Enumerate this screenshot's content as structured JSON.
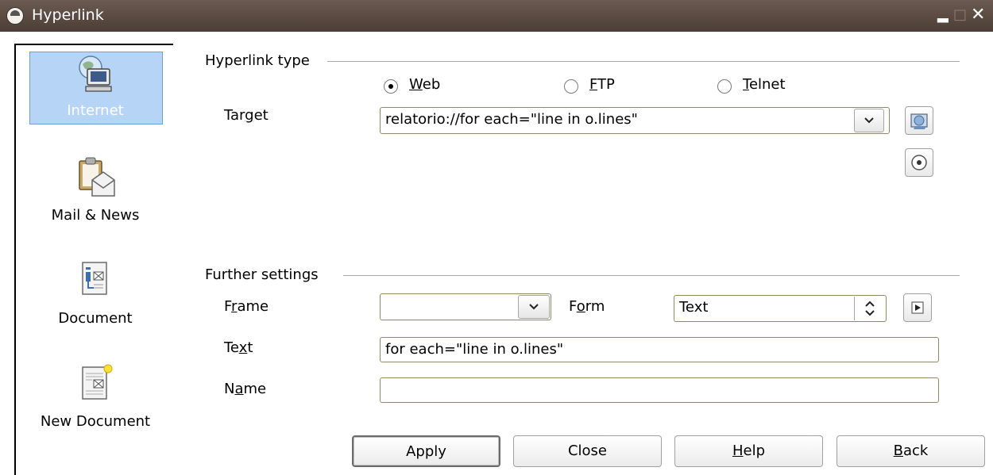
{
  "window": {
    "title": "Hyperlink",
    "minimize_label": "▂",
    "maximize_label": "□",
    "close_label": "✕"
  },
  "sidebar": {
    "items": [
      {
        "label": "Internet",
        "icon": "globe-computer-icon",
        "selected": true
      },
      {
        "label": "Mail & News",
        "icon": "clipboard-mail-icon",
        "selected": false
      },
      {
        "label": "Document",
        "icon": "document-icon",
        "selected": false
      },
      {
        "label": "New Document",
        "icon": "new-document-icon",
        "selected": false
      }
    ]
  },
  "hyperlink_type": {
    "heading": "Hyperlink type",
    "options": [
      {
        "label": "Web",
        "mnemonic": "W",
        "rest": "eb",
        "checked": true
      },
      {
        "label": "FTP",
        "mnemonic": "F",
        "rest": "TP",
        "checked": false
      },
      {
        "label": "Telnet",
        "mnemonic": "T",
        "rest": "elnet",
        "checked": false
      }
    ],
    "target_label_pre": "Tar",
    "target_label_mn": "g",
    "target_label_post": "et",
    "target_value": "relatorio://for each=\"line in o.lines\""
  },
  "further": {
    "heading": "Further settings",
    "frame_pre": "F",
    "frame_mn": "r",
    "frame_post": "ame",
    "frame_value": "",
    "form_pre": "F",
    "form_mn": "o",
    "form_post": "rm",
    "form_value": "Text",
    "text_pre": "Te",
    "text_mn": "x",
    "text_post": "t",
    "text_value": "for each=\"line in o.lines\"",
    "name_pre": "N",
    "name_mn": "a",
    "name_post": "me",
    "name_value": ""
  },
  "buttons": {
    "apply": "Apply",
    "close": "Close",
    "help_mn": "H",
    "help_post": "elp",
    "back_mn": "B",
    "back_post": "ack"
  },
  "colors": {
    "titlebar": "#5a4a42",
    "selection": "#b6d4f5",
    "field_border": "#8c8a66"
  }
}
